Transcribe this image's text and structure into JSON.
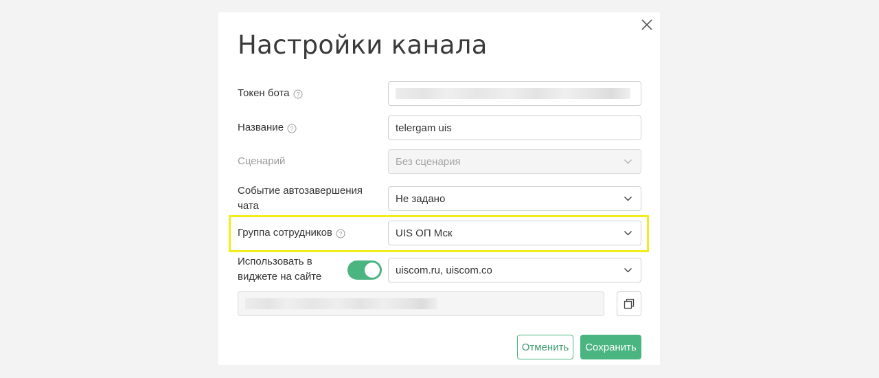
{
  "dialog": {
    "title": "Настройки канала",
    "close_icon": "close-icon"
  },
  "fields": {
    "bot_token": {
      "label": "Токен бота",
      "value": ""
    },
    "name": {
      "label": "Название",
      "value": "telergam uis"
    },
    "scenario": {
      "label": "Сценарий",
      "value": "Без сценария"
    },
    "auto_finish": {
      "label_line1": "Событие автозавершения",
      "label_line2": "чата",
      "value": "Не задано"
    },
    "employee_group": {
      "label": "Группа сотрудников",
      "value": "UIS ОП Мск"
    },
    "widget": {
      "label_line1": "Использовать в",
      "label_line2": "виджете на сайте",
      "enabled": true,
      "value": "uiscom.ru, uiscom.co"
    },
    "widget_code": {
      "value": ""
    }
  },
  "buttons": {
    "cancel": "Отменить",
    "save": "Сохранить"
  },
  "colors": {
    "accent": "#4ab581",
    "highlight": "#f2ec1a",
    "background": "#f3f3f3"
  }
}
